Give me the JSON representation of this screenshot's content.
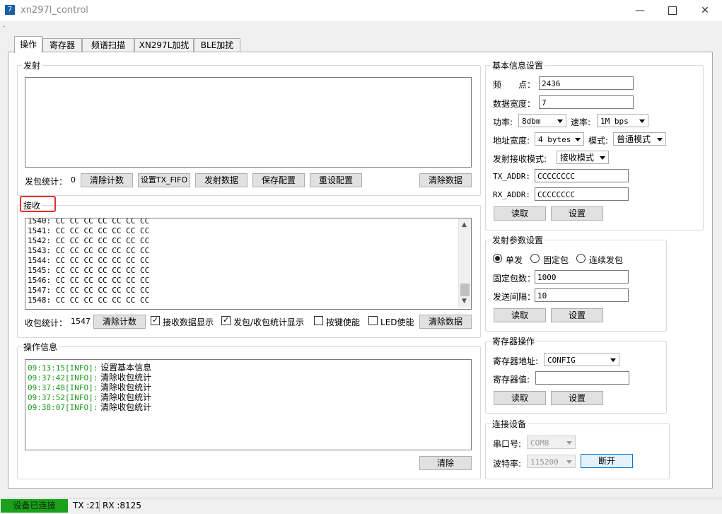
{
  "window": {
    "title": "xn297l_control",
    "app_icon": "7",
    "minimize_icon": "minimize-icon",
    "maximize_icon": "maximize-icon",
    "close_icon": "close-icon"
  },
  "tabs": [
    {
      "label": "操作",
      "active": true
    },
    {
      "label": "寄存器",
      "active": false
    },
    {
      "label": "频谱扫描",
      "active": false
    },
    {
      "label": "XN297L加扰",
      "active": false
    },
    {
      "label": "BLE加扰",
      "active": false
    }
  ],
  "transmit": {
    "group_label": "发射",
    "stats_label": "发包统计：",
    "stats_value": "0",
    "buttons": [
      "清除计数",
      "设置TX_FIFO",
      "发射数据",
      "保存配置",
      "重设配置",
      "清除数据"
    ]
  },
  "receive": {
    "group_label": "接收",
    "lines": [
      "1540: CC CC CC CC CC CC CC",
      "1541: CC CC CC CC CC CC CC",
      "1542: CC CC CC CC CC CC CC",
      "1543: CC CC CC CC CC CC CC",
      "1544: CC CC CC CC CC CC CC",
      "1545: CC CC CC CC CC CC CC",
      "1546: CC CC CC CC CC CC CC",
      "1547: CC CC CC CC CC CC CC",
      "1548: CC CC CC CC CC CC CC"
    ],
    "stats_label": "收包统计：",
    "stats_value": "1547",
    "clear_count_button": "清除计数",
    "checkboxes": [
      {
        "label": "接收数据显示",
        "checked": true
      },
      {
        "label": "发包/收包统计显示",
        "checked": true
      },
      {
        "label": "按键使能",
        "checked": false
      },
      {
        "label": "LED使能",
        "checked": false
      }
    ],
    "clear_data_button": "清除数据",
    "highlight_color": "#e0302a"
  },
  "oplog": {
    "group_label": "操作信息",
    "entries": [
      {
        "time": "09:13:15",
        "tag": "[INFO]:",
        "msg": "设置基本信息"
      },
      {
        "time": "09:37:42",
        "tag": "[INFO]:",
        "msg": "清除收包统计"
      },
      {
        "time": "09:37:48",
        "tag": "[INFO]:",
        "msg": "清除收包统计"
      },
      {
        "time": "09:37:52",
        "tag": "[INFO]:",
        "msg": "清除收包统计"
      },
      {
        "time": "09:38:07",
        "tag": "[INFO]:",
        "msg": "清除收包统计"
      }
    ],
    "green_color": "#1a9a1a",
    "clear_button": "清除"
  },
  "basic": {
    "group_label": "基本信息设置",
    "freq_label": "频　　点：",
    "freq_value": "2436",
    "width_label": "数据宽度：",
    "width_value": "7",
    "power_label": "功率:",
    "power_value": "8dbm",
    "rate_label": "速率:",
    "rate_value": "1M bps",
    "addrw_label": "地址宽度:",
    "addrw_value": "4 bytes",
    "mode_label": "模式:",
    "mode_value": "普通模式",
    "txrx_label": "发射接收模式:",
    "txrx_value": "接收模式",
    "tx_addr_label": "TX_ADDR:",
    "tx_addr_value": "CCCCCCCC",
    "rx_addr_label": "RX_ADDR:",
    "rx_addr_value": "CCCCCCCC",
    "read_button": "读取",
    "set_button": "设置"
  },
  "txparam": {
    "group_label": "发射参数设置",
    "radios": [
      {
        "label": "单发",
        "checked": true
      },
      {
        "label": "固定包",
        "checked": false
      },
      {
        "label": "连续发包",
        "checked": false
      }
    ],
    "fixed_label": "固定包数：",
    "fixed_value": "1000",
    "interval_label": "发送间隔：",
    "interval_value": "10",
    "read_button": "读取",
    "set_button": "设置"
  },
  "regop": {
    "group_label": "寄存器操作",
    "addr_label": "寄存器地址:",
    "addr_value": "CONFIG",
    "value_label": "寄存器值:",
    "value_value": "",
    "read_button": "读取",
    "set_button": "设置"
  },
  "conn": {
    "group_label": "连接设备",
    "port_label": "串口号:",
    "port_value": "COM8",
    "baud_label": "波特率:",
    "baud_value": "115200",
    "disconnect_button": "断开"
  },
  "status": {
    "connected": "设备已连接",
    "connected_color": "#1aa01a",
    "tx": "TX :21",
    "rx": "RX :8125"
  }
}
